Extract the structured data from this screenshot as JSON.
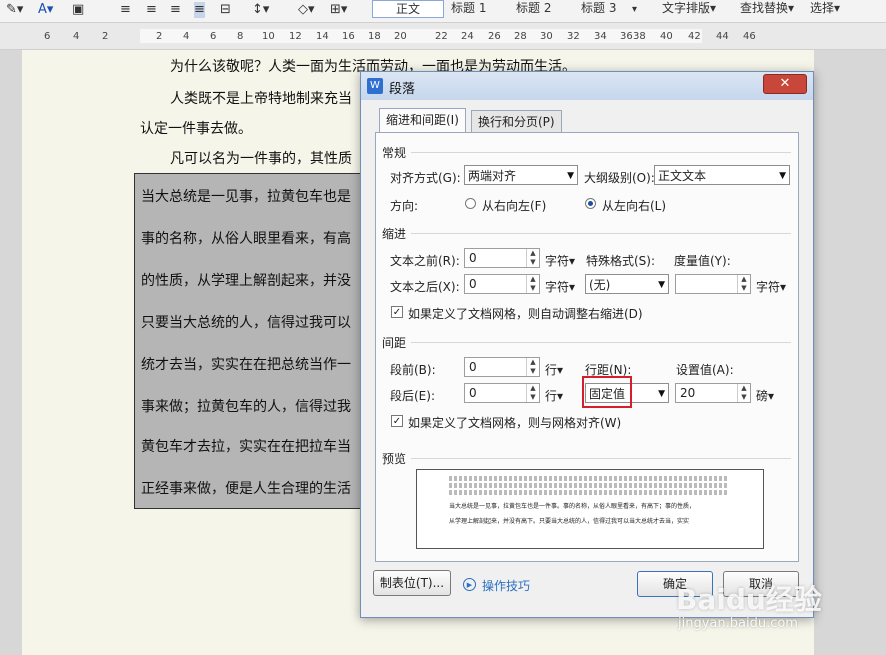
{
  "toolbar": {
    "styles": [
      "正文",
      "标题 1",
      "标题 2",
      "标题 3"
    ],
    "text_layout": "文字排版",
    "find_replace": "查找替换",
    "select": "选择"
  },
  "ruler": {
    "ticks_left": [
      "6",
      "4",
      "2",
      "2",
      "4",
      "6",
      "8",
      "10",
      "12",
      "14",
      "16",
      "18",
      "20",
      "22",
      "24",
      "26",
      "28",
      "30",
      "32",
      "34",
      "36",
      "38",
      "40",
      "42",
      "44",
      "46"
    ]
  },
  "document": {
    "lines": [
      "为什么该敬呢？人类一面为生活而劳动，一面也是为劳动而生活。",
      "人类既不是上帝特地制来充当",
      "认定一件事去做。",
      "凡可以名为一件事的，其性质",
      "当大总统是一见事，拉黄包车也是",
      "事的名称，从俗人眼里看来，有高",
      "的性质，从学理上解剖起来，并没",
      "只要当大总统的人，信得过我可以",
      "统才去当，实实在在把总统当作一",
      "事来做；拉黄包车的人，信得过我",
      "黄包车才去拉，实实在在把拉车当",
      "正经事来做，便是人生合理的生活"
    ]
  },
  "dialog": {
    "title": "段落",
    "app_logo": "W",
    "close": "✕",
    "tabs": [
      "缩进和间距(I)",
      "换行和分页(P)"
    ],
    "general": {
      "heading": "常规",
      "align_label": "对齐方式(G):",
      "align_value": "两端对齐",
      "outline_label": "大纲级别(O):",
      "outline_value": "正文文本",
      "direction_label": "方向:",
      "rtl_label": "从右向左(F)",
      "ltr_label": "从左向右(L)"
    },
    "indent": {
      "heading": "缩进",
      "before_label": "文本之前(R):",
      "before_value": "0",
      "before_unit": "字符▾",
      "after_label": "文本之后(X):",
      "after_value": "0",
      "after_unit": "字符▾",
      "special_label": "特殊格式(S):",
      "special_value": "(无)",
      "measure_label": "度量值(Y):",
      "measure_value": "",
      "measure_unit": "字符▾",
      "auto_adjust": "如果定义了文档网格，则自动调整右缩进(D)"
    },
    "spacing": {
      "heading": "间距",
      "before_label": "段前(B):",
      "before_value": "0",
      "before_unit": "行▾",
      "after_label": "段后(E):",
      "after_value": "0",
      "after_unit": "行▾",
      "line_label": "行距(N):",
      "line_value": "固定值",
      "setting_label": "设置值(A):",
      "setting_value": "20",
      "setting_unit": "磅▾",
      "snap_grid": "如果定义了文档网格，则与网格对齐(W)"
    },
    "preview": {
      "heading": "预览",
      "text_line1": "当大总统是一见事，拉黄包车也是一件事。事的名称，从俗人眼里看来，有高下；事的性质，",
      "text_line2": "从学理上解剖起来，并没有高下。只要当大总统的人，信得过我可以当大总统才去当，实实"
    },
    "buttons": {
      "tabs": "制表位(T)...",
      "tips": "操作技巧",
      "ok": "确定",
      "cancel": "取消"
    }
  },
  "watermark": {
    "brand": "Baidu经验",
    "url": "jingyan.baidu.com"
  }
}
